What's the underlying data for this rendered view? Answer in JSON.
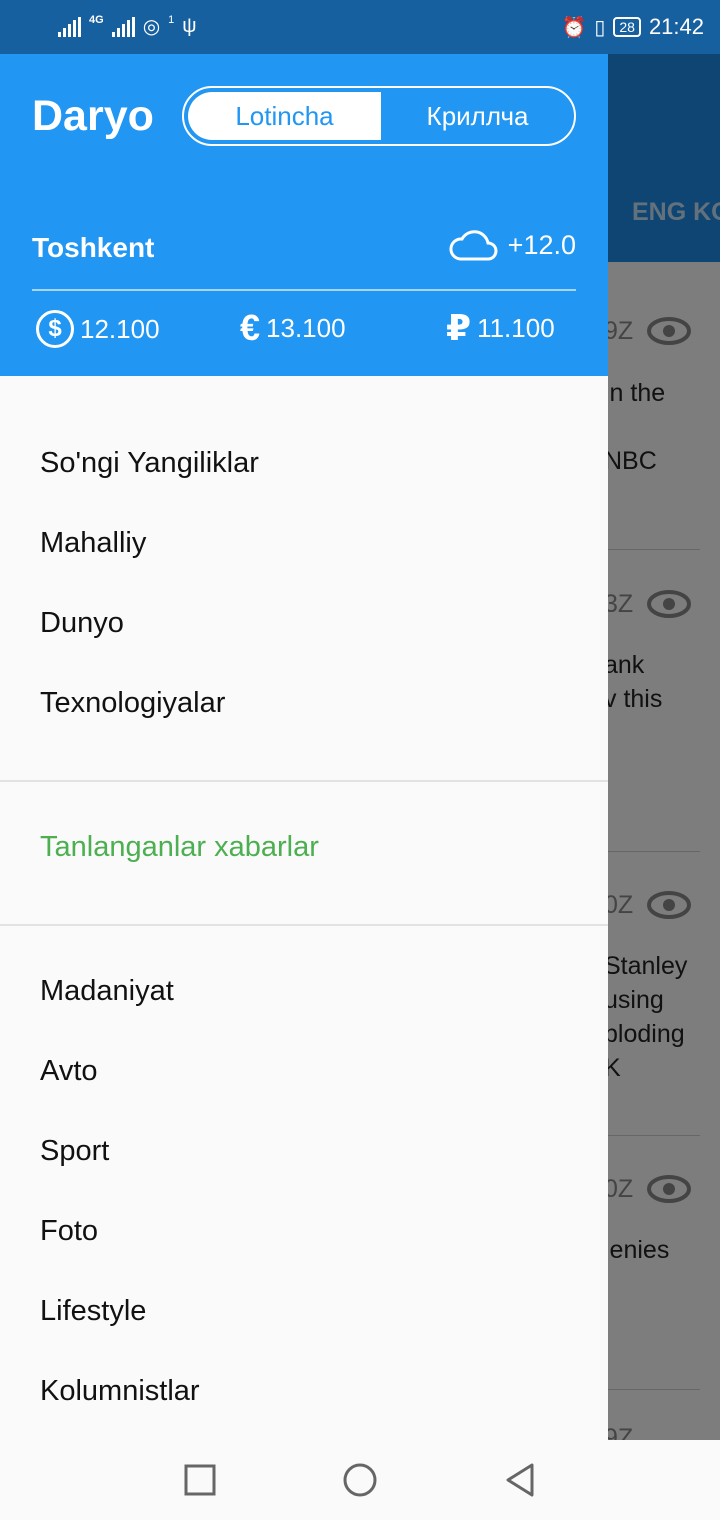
{
  "status_bar": {
    "time": "21:42",
    "battery": "28",
    "network": "4G",
    "sim_index": "1"
  },
  "background": {
    "tab_label": "ENG KO",
    "cards": [
      {
        "meta": "9Z",
        "lines": [
          "in the",
          "'",
          "NBC"
        ]
      },
      {
        "meta": "3Z",
        "lines": [
          "ank",
          "v this"
        ]
      },
      {
        "meta": "0Z",
        "lines": [
          "Stanley",
          "using",
          "ploding",
          "K"
        ]
      },
      {
        "meta": "0Z",
        "lines": [
          "lenies"
        ]
      },
      {
        "meta": "9Z",
        "lines": []
      }
    ]
  },
  "drawer": {
    "brand": "Daryo",
    "lang_latin": "Lotincha",
    "lang_cyrillic": "Криллча",
    "city": "Toshkent",
    "temperature": "+12.0",
    "rates": {
      "usd": "12.100",
      "eur": "13.100",
      "rub": "11.100"
    },
    "menu_primary": [
      "So'ngi Yangiliklar",
      "Mahalliy",
      "Dunyo",
      "Texnologiyalar"
    ],
    "menu_favorites": "Tanlanganlar xabarlar",
    "menu_secondary": [
      "Madaniyat",
      "Avto",
      "Sport",
      "Foto",
      "Lifestyle",
      "Kolumnistlar"
    ],
    "accent_color": "#4caf50",
    "header_color": "#2196f3"
  },
  "icons": {
    "weather": "cloud-icon",
    "usd": "dollar-icon",
    "eur": "euro-icon",
    "rub": "ruble-icon",
    "recent": "square-icon",
    "home": "circle-icon",
    "back": "triangle-back-icon"
  }
}
